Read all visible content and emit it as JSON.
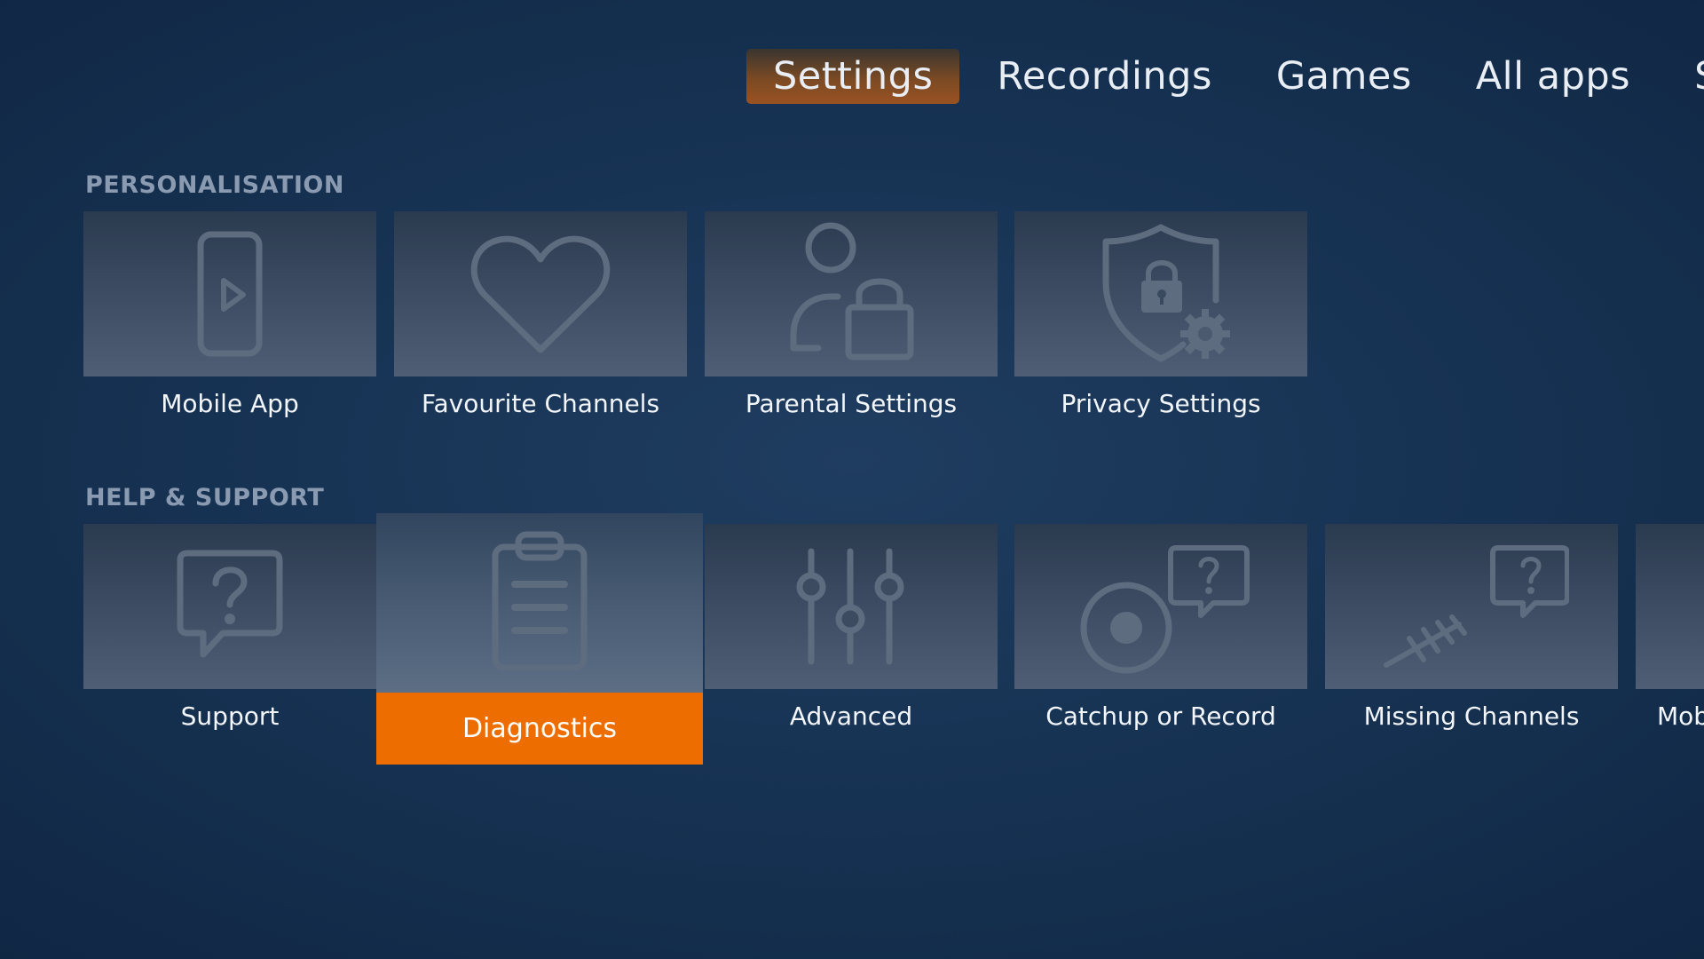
{
  "nav": {
    "items": [
      "Settings",
      "Recordings",
      "Games",
      "All apps",
      "Se"
    ],
    "active_index": 0
  },
  "sections": [
    {
      "title": "PERSONALISATION",
      "tiles": [
        {
          "label": "Mobile App",
          "icon": "mobile-play-icon"
        },
        {
          "label": "Favourite Channels",
          "icon": "heart-icon"
        },
        {
          "label": "Parental Settings",
          "icon": "user-lock-icon"
        },
        {
          "label": "Privacy Settings",
          "icon": "shield-lock-gear-icon"
        }
      ]
    },
    {
      "title": "HELP & SUPPORT",
      "tiles": [
        {
          "label": "Support",
          "icon": "question-bubble-icon"
        },
        {
          "label": "Diagnostics",
          "icon": "clipboard-icon",
          "focused": true
        },
        {
          "label": "Advanced",
          "icon": "sliders-icon"
        },
        {
          "label": "Catchup or Record",
          "icon": "record-question-icon"
        },
        {
          "label": "Missing Channels",
          "icon": "broken-antenna-question-icon"
        },
        {
          "label": "Mob",
          "icon": ""
        }
      ]
    }
  ],
  "colors": {
    "background": "#173354",
    "focus_accent": "#ee6d00",
    "active_nav": "#9a5222",
    "section_title": "#8a9ab0",
    "icon": "#5e6c80"
  }
}
